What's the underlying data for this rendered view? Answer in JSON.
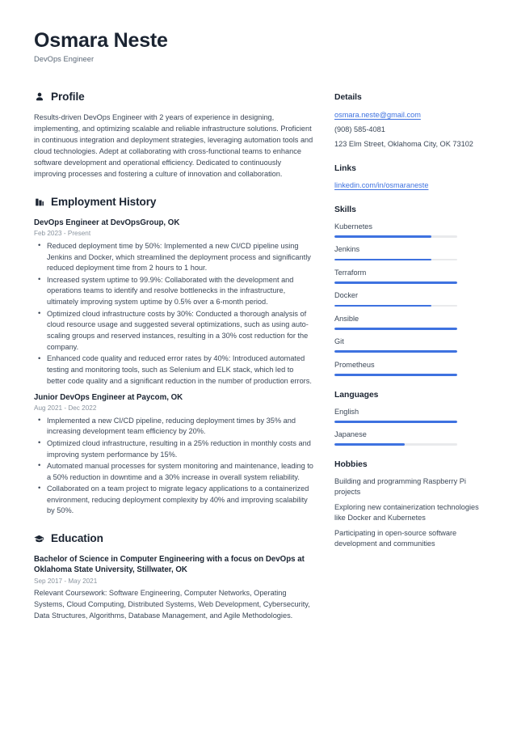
{
  "theme": {
    "accent": "#3e72e0",
    "heading": "#1b2432",
    "body_text": "#3b4757",
    "muted": "#8a949f",
    "track": "#e9eaec",
    "background": "#ffffff"
  },
  "header": {
    "full_name": "Osmara Neste",
    "job_title": "DevOps Engineer"
  },
  "profile": {
    "icon": "user-icon",
    "title": "Profile",
    "text": "Results-driven DevOps Engineer with 2 years of experience in designing, implementing, and optimizing scalable and reliable infrastructure solutions. Proficient in continuous integration and deployment strategies, leveraging automation tools and cloud technologies. Adept at collaborating with cross-functional teams to enhance software development and operational efficiency. Dedicated to continuously improving processes and fostering a culture of innovation and collaboration."
  },
  "employment": {
    "icon": "briefcase-icon",
    "title": "Employment History",
    "jobs": [
      {
        "title": "DevOps Engineer at DevOpsGroup, OK",
        "date": "Feb 2023 - Present",
        "bullets": [
          "Reduced deployment time by 50%: Implemented a new CI/CD pipeline using Jenkins and Docker, which streamlined the deployment process and significantly reduced deployment time from 2 hours to 1 hour.",
          "Increased system uptime to 99.9%: Collaborated with the development and operations teams to identify and resolve bottlenecks in the infrastructure, ultimately improving system uptime by 0.5% over a 6-month period.",
          "Optimized cloud infrastructure costs by 30%: Conducted a thorough analysis of cloud resource usage and suggested several optimizations, such as using auto-scaling groups and reserved instances, resulting in a 30% cost reduction for the company.",
          "Enhanced code quality and reduced error rates by 40%: Introduced automated testing and monitoring tools, such as Selenium and ELK stack, which led to better code quality and a significant reduction in the number of production errors."
        ]
      },
      {
        "title": "Junior DevOps Engineer at Paycom, OK",
        "date": "Aug 2021 - Dec 2022",
        "bullets": [
          "Implemented a new CI/CD pipeline, reducing deployment times by 35% and increasing development team efficiency by 20%.",
          "Optimized cloud infrastructure, resulting in a 25% reduction in monthly costs and improving system performance by 15%.",
          "Automated manual processes for system monitoring and maintenance, leading to a 50% reduction in downtime and a 30% increase in overall system reliability.",
          "Collaborated on a team project to migrate legacy applications to a containerized environment, reducing deployment complexity by 40% and improving scalability by 50%."
        ]
      }
    ]
  },
  "education": {
    "icon": "graduation-cap-icon",
    "title": "Education",
    "entries": [
      {
        "title": "Bachelor of Science in Computer Engineering with a focus on DevOps at Oklahoma State University, Stillwater, OK",
        "date": "Sep 2017 - May 2021",
        "note": "Relevant Coursework: Software Engineering, Computer Networks, Operating Systems, Cloud Computing, Distributed Systems, Web Development, Cybersecurity, Data Structures, Algorithms, Database Management, and Agile Methodologies."
      }
    ]
  },
  "details": {
    "title": "Details",
    "email": "osmara.neste@gmail.com",
    "phone": "(908) 585-4081",
    "address": "123 Elm Street, Oklahoma City, OK 73102"
  },
  "links": {
    "title": "Links",
    "items": [
      {
        "label": "linkedin.com/in/osmaraneste"
      }
    ]
  },
  "skills": {
    "title": "Skills",
    "items": [
      {
        "label": "Kubernetes",
        "level": 79
      },
      {
        "label": "Jenkins",
        "level": 79
      },
      {
        "label": "Terraform",
        "level": 100
      },
      {
        "label": "Docker",
        "level": 79
      },
      {
        "label": "Ansible",
        "level": 100
      },
      {
        "label": "Git",
        "level": 100
      },
      {
        "label": "Prometheus",
        "level": 100
      }
    ]
  },
  "languages": {
    "title": "Languages",
    "items": [
      {
        "label": "English",
        "level": 100
      },
      {
        "label": "Japanese",
        "level": 57
      }
    ]
  },
  "hobbies": {
    "title": "Hobbies",
    "items": [
      "Building and programming Raspberry Pi projects",
      "Exploring new containerization technologies like Docker and Kubernetes",
      "Participating in open-source software development and communities"
    ]
  }
}
